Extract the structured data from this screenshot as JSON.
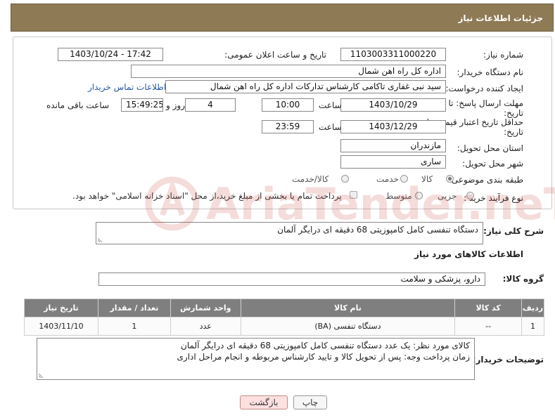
{
  "header": {
    "title": "جزئیات اطلاعات نیاز"
  },
  "fields": {
    "need_number_label": "شماره نیاز:",
    "need_number": "1103003311000220",
    "announce_label": "تاریخ و ساعت اعلان عمومی:",
    "announce_value": "1403/10/24 - 17:42",
    "buyer_org_label": "نام دستگاه خریدار:",
    "buyer_org": "اداره کل راه اهن شمال",
    "creator_label": "ایجاد کننده درخواست:",
    "creator": "سید نبی غفاری تاکامی کارشناس تدارکات اداره کل راه اهن شمال",
    "contact_link": "اطلاعات تماس خریدار",
    "deadline_label_1": "مهلت ارسال پاسخ: تا",
    "deadline_label_2": "تاریخ:",
    "deadline_date": "1403/10/29",
    "time_label": "ساعت",
    "deadline_time": "10:00",
    "days_value": "4",
    "days_label": "روز و",
    "remaining_time": "15:49:25",
    "remaining_label": "ساعت باقی مانده",
    "min_validity_label_1": "حداقل تاریخ اعتبار قیمت: تا",
    "min_validity_label_2": "تاریخ:",
    "validity_date": "1403/12/29",
    "validity_time_label": "ساعت",
    "validity_time": "23:59",
    "province_label": "استان محل تحویل:",
    "province": "مازندران",
    "city_label": "شهر محل تحویل:",
    "city": "ساری",
    "category_label": "طبقه بندی موضوعی:",
    "category_options": [
      "کالا",
      "خدمت",
      "کالا/خدمت"
    ],
    "category_selected": "کالا",
    "purchase_type_label": "نوع فرآیند خرید :",
    "purchase_options": [
      "جزیی",
      "متوسط"
    ],
    "payment_note": "پرداخت تمام یا بخشی از مبلغ خرید،از محل \"اسناد خزانه اسلامی\" خواهد بود."
  },
  "general_description": {
    "label": "شرح کلی نیاز:",
    "value": "دستگاه تنفسی کامل کامپوزیتی 68 دقیقه ای درایگر آلمان"
  },
  "goods_section": {
    "title": "اطلاعات کالاهای مورد نیاز",
    "group_label": "گروه کالا:",
    "group_value": "دارو، پزشکی و سلامت"
  },
  "table": {
    "headers": [
      "ردیف",
      "کد کالا",
      "نام کالا",
      "واحد شمارش",
      "تعداد / مقدار",
      "تاریخ نیاز"
    ],
    "rows": [
      [
        "1",
        "--",
        "دستگاه تنفسی (BA)",
        "عدد",
        "1",
        "1403/11/10"
      ]
    ]
  },
  "buyer_notes": {
    "label": "توضیحات خریدار:",
    "line1": "کالای مورد نظر: یک عدد دستگاه تنفسی کامل کامپوزیتی 68 دقیقه ای درایگر آلمان",
    "line2": "زمان پرداخت وجه: پس از تحویل کالا و تایید کارشناس مربوطه و انجام مراحل اداری"
  },
  "buttons": {
    "print": "چاپ",
    "back": "بازگشت"
  },
  "watermark": {
    "text": "AriaTender.neT"
  },
  "colors": {
    "header": "#8e7a55",
    "table_header": "#7f7f7f",
    "link": "#2a58a8",
    "watermark": "#c0392b"
  }
}
